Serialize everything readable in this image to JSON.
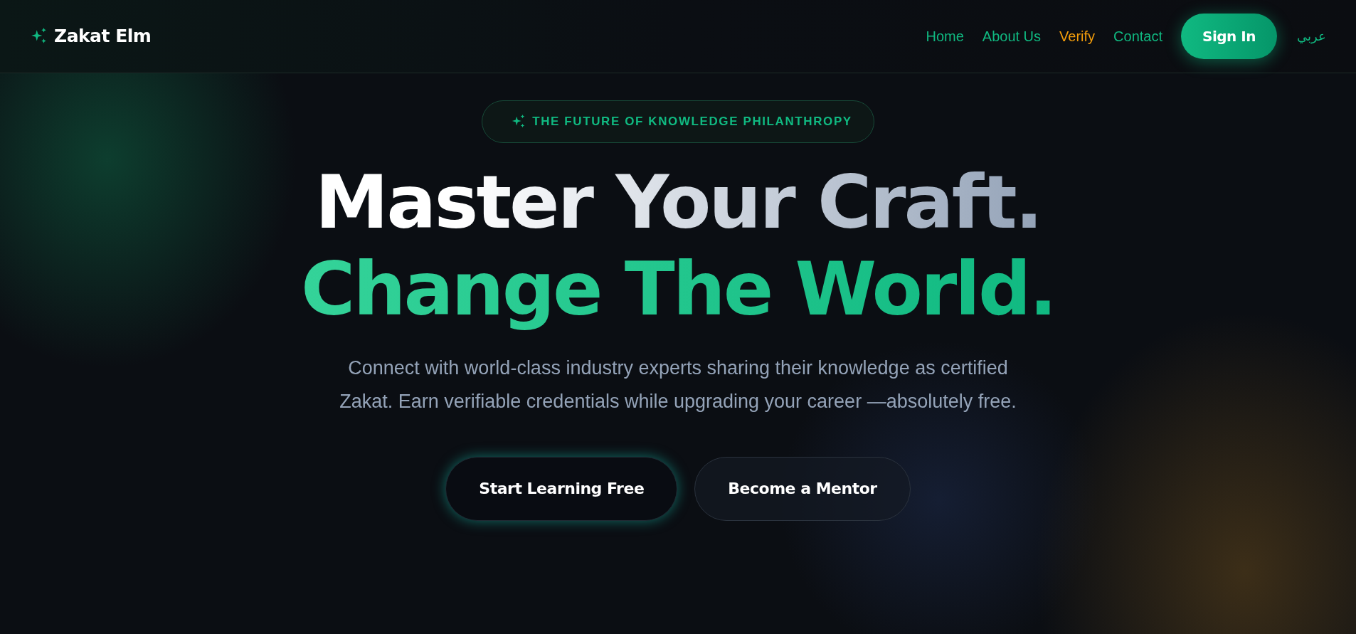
{
  "brand": {
    "name": "Zakat Elm"
  },
  "nav": {
    "links": [
      {
        "label": "Home",
        "kind": "link"
      },
      {
        "label": "About Us",
        "kind": "link"
      },
      {
        "label": "Verify",
        "kind": "highlight"
      },
      {
        "label": "Contact",
        "kind": "link"
      }
    ],
    "sign_in": "Sign In",
    "language": "عربي"
  },
  "hero": {
    "badge": "THE FUTURE OF KNOWLEDGE PHILANTHROPY",
    "title_line_1": "Master Your Craft.",
    "title_line_2": "Change The World.",
    "description": "Connect with world-class industry experts sharing their knowledge as certified Zakat. Earn verifiable credentials while upgrading your career —absolutely free.",
    "buttons": [
      {
        "label": "Start Learning Free",
        "kind": "primary"
      },
      {
        "label": "Become a Mentor",
        "kind": "secondary"
      }
    ]
  }
}
